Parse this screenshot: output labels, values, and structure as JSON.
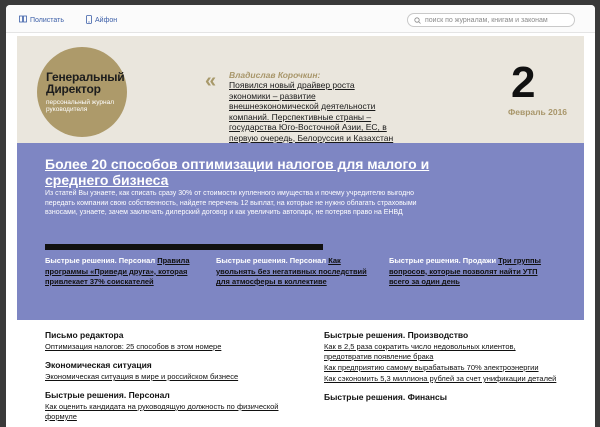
{
  "toolbar": {
    "read_label": "Полистать",
    "iphone_label": "Айфон",
    "search_placeholder": "поиск по журналам, книгам и законам"
  },
  "masthead": {
    "logo_line1": "Генеральный",
    "logo_line2": "Директор",
    "logo_sub1": "персональный журнал",
    "logo_sub2": "руководителя",
    "quote_mark": "«",
    "quote_author": "Владислав Корочкин:",
    "quote_text": "Появился новый драйвер роста экономики – развитие внешнеэкономической деятельности компаний. Перспективные страны – государства Юго-Восточной Азии, ЕС, в первую очередь, Белоруссия и Казахстан",
    "issue_number": "2",
    "issue_date": "Февраль 2016"
  },
  "hero": {
    "title": "Более 20 способов оптимизации налогов для малого и среднего бизнеса",
    "lead": "Из статей Вы узнаете, как списать сразу 30% от стоимости купленного имущества и почему учредителю выгодно передать компании свою собственность, найдете перечень 12 выплат, на которые не нужно облагать страховыми взносами, узнаете, зачем заключать дилерский договор и как увеличить автопарк, не потеряв право на ЕНВД",
    "columns": [
      {
        "head": "Быстрые решения. Персонал",
        "link": "Правила программы «Приведи друга», которая привлекает 37% соискателей"
      },
      {
        "head": "Быстрые решения. Персонал",
        "link": "Как увольнять без негативных последствий для атмосферы в коллективе"
      },
      {
        "head": "Быстрые решения. Продажи",
        "link": "Три группы вопросов, которые позволят найти УТП всего за один день"
      }
    ]
  },
  "left_sections": [
    {
      "head": "Письмо редактора",
      "links": [
        "Оптимизация налогов: 25 способов в этом номере"
      ]
    },
    {
      "head": "Экономическая ситуация",
      "links": [
        "Экономическая ситуация в мире и российском бизнесе"
      ]
    },
    {
      "head": "Быстрые решения. Персонал",
      "links": [
        "Как оценить кандидата на руководящую должность по физической формуле"
      ]
    }
  ],
  "right_sections": [
    {
      "head": "Быстрые решения. Производство",
      "links": [
        "Как в 2,5 раза сократить число недовольных клиентов, предотвратив появление брака",
        "Как предприятию самому вырабатывать 70% электроэнергии",
        "Как сэкономить 5,3 миллиона рублей за счет унификации деталей"
      ]
    },
    {
      "head": "Быстрые решения. Финансы",
      "links": []
    }
  ]
}
